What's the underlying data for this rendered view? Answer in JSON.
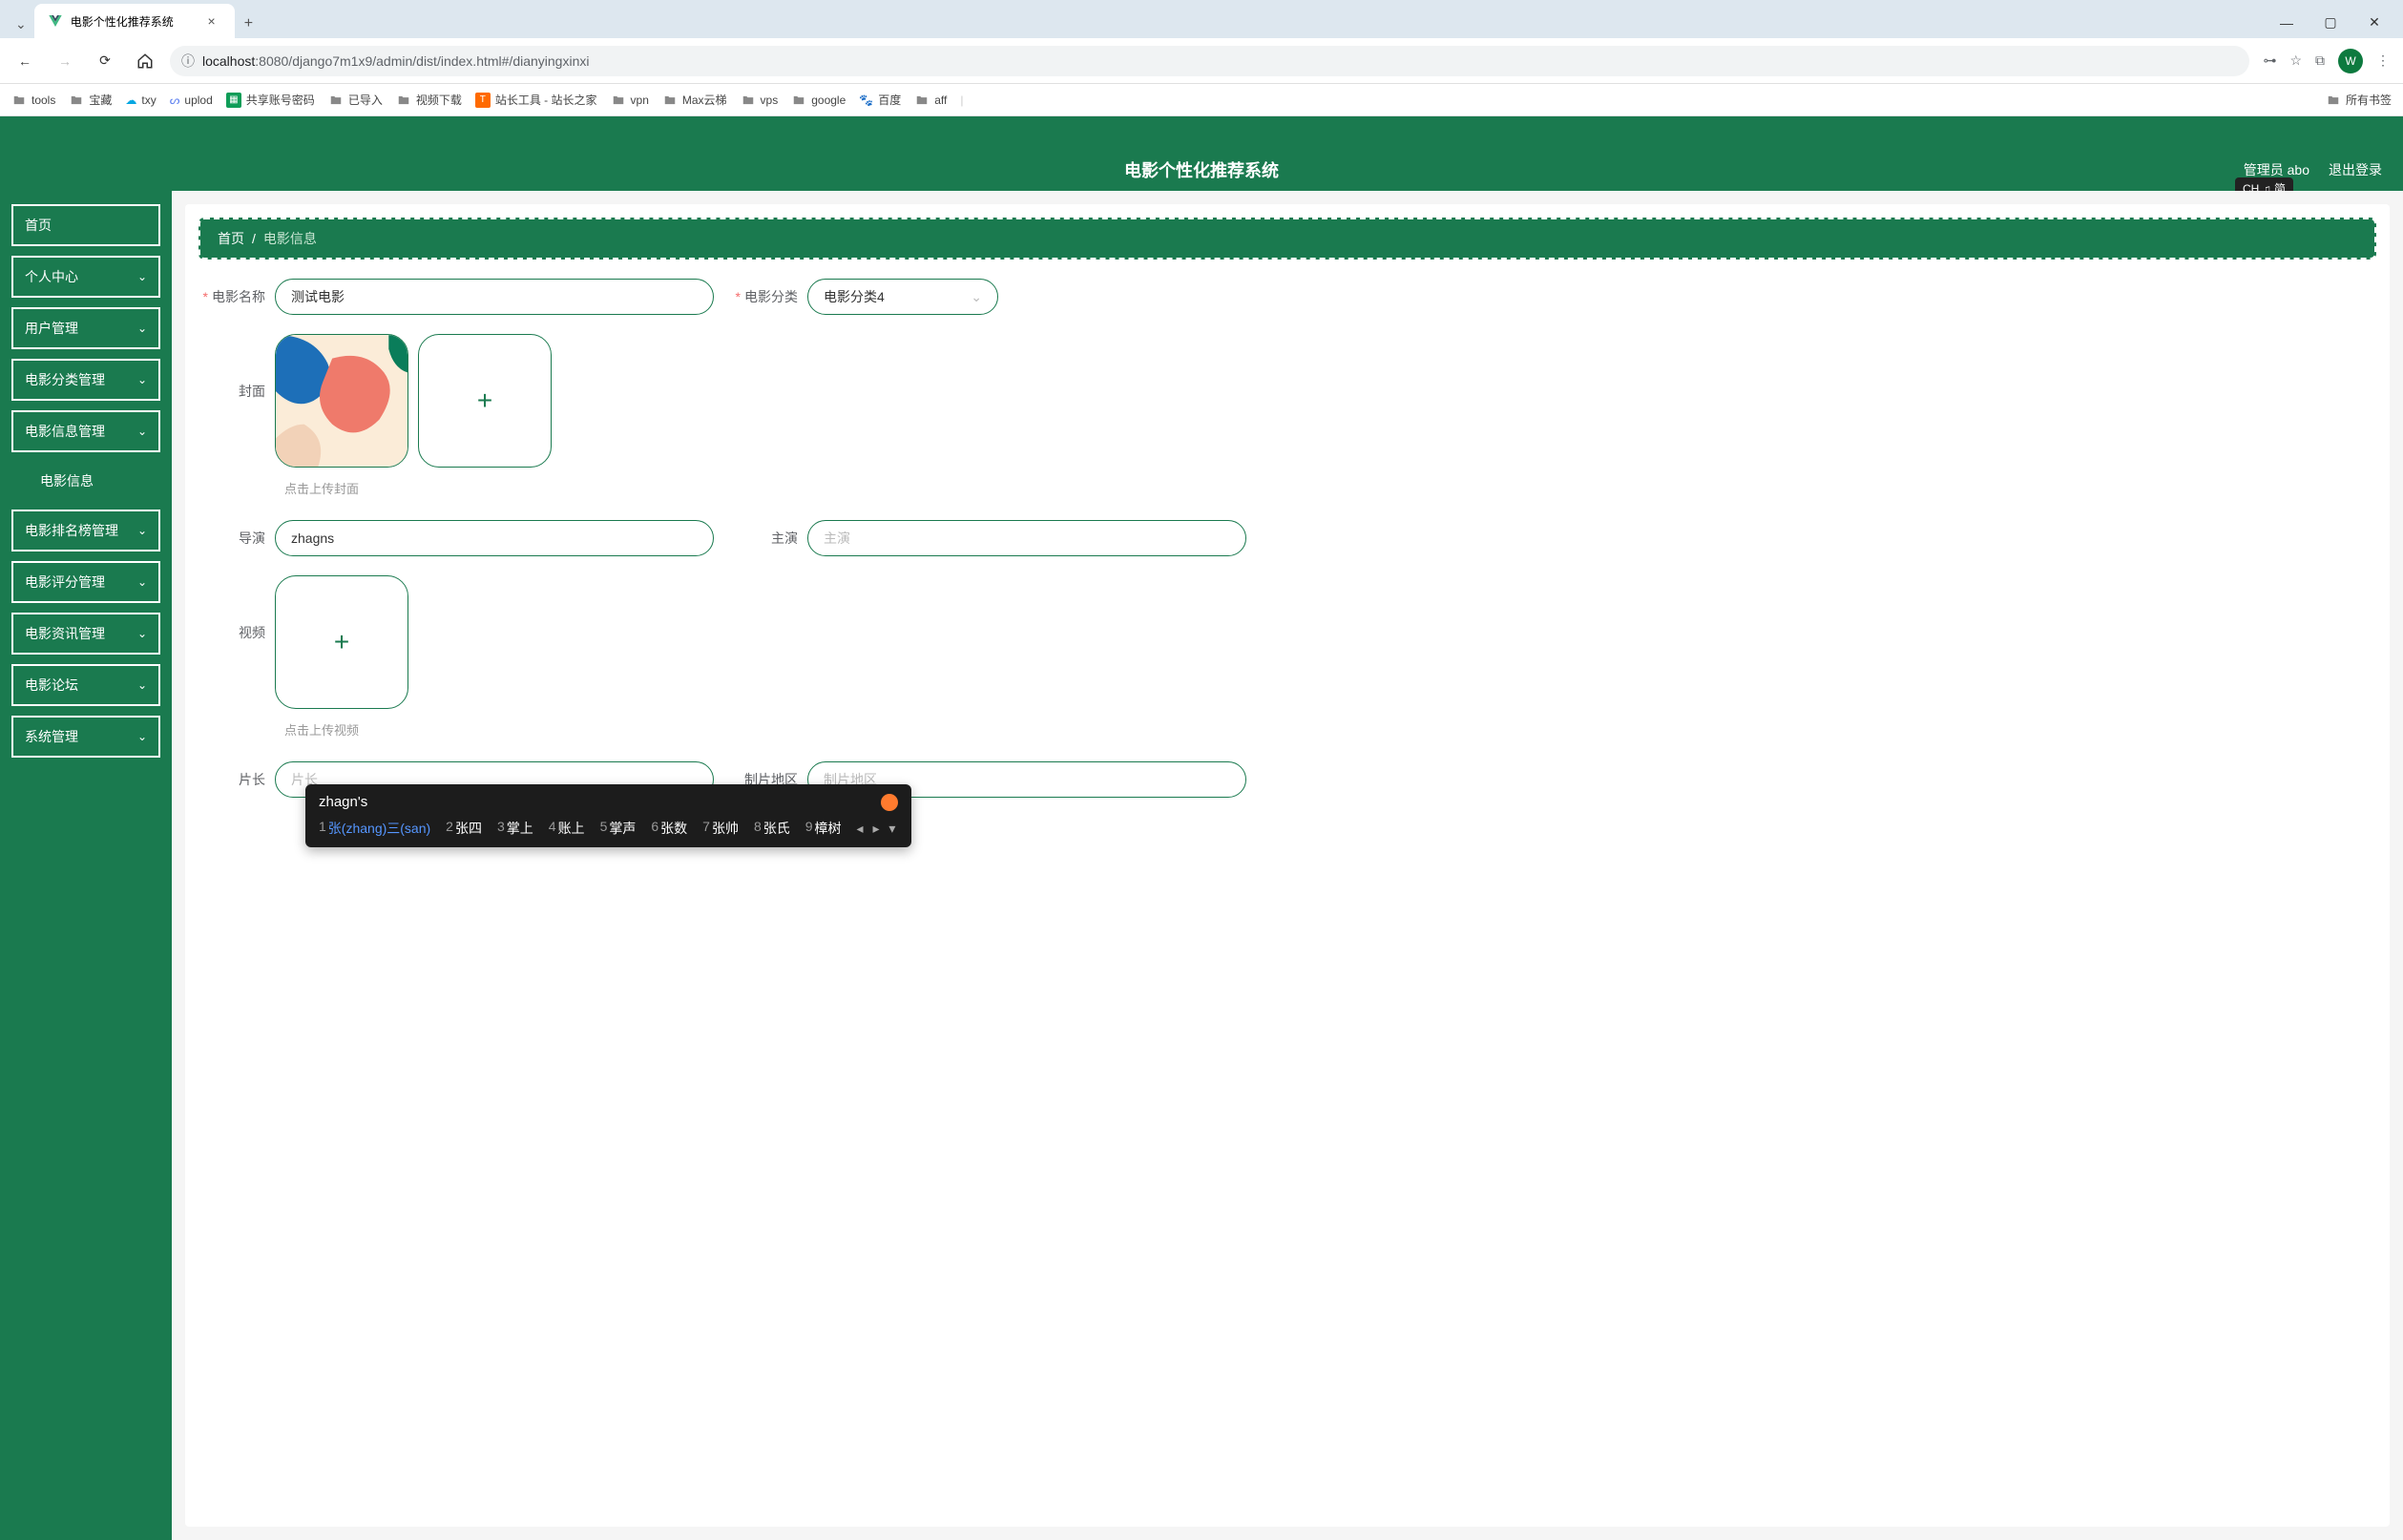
{
  "browser": {
    "tab_title": "电影个性化推荐系统",
    "url_host": "localhost",
    "url_path": ":8080/django7m1x9/admin/dist/index.html#/dianyingxinxi",
    "avatar_letter": "W"
  },
  "bookmarks": {
    "items": [
      "tools",
      "宝藏",
      "txy",
      "uplod",
      "共享账号密码",
      "已导入",
      "视频下载",
      "站长工具 - 站长之家",
      "vpn",
      "Max云梯",
      "vps",
      "google",
      "百度",
      "aff"
    ],
    "all": "所有书签"
  },
  "app": {
    "title": "电影个性化推荐系统",
    "admin_label": "管理员 abo",
    "logout": "退出登录",
    "ime_badge": "CH ♫ 简"
  },
  "sidebar": {
    "items": [
      {
        "label": "首页",
        "has_children": false
      },
      {
        "label": "个人中心",
        "has_children": true
      },
      {
        "label": "用户管理",
        "has_children": true
      },
      {
        "label": "电影分类管理",
        "has_children": true
      },
      {
        "label": "电影信息管理",
        "has_children": true
      },
      {
        "label": "电影排名榜管理",
        "has_children": true
      },
      {
        "label": "电影评分管理",
        "has_children": true
      },
      {
        "label": "电影资讯管理",
        "has_children": true
      },
      {
        "label": "电影论坛",
        "has_children": true
      },
      {
        "label": "系统管理",
        "has_children": true
      }
    ],
    "submenu_movie_info": "电影信息"
  },
  "breadcrumb": {
    "home": "首页",
    "current": "电影信息"
  },
  "form": {
    "movie_name_label": "电影名称",
    "movie_name_value": "测试电影",
    "movie_cat_label": "电影分类",
    "movie_cat_value": "电影分类4",
    "cover_label": "封面",
    "cover_hint": "点击上传封面",
    "director_label": "导演",
    "director_value": "zhagns",
    "actor_label": "主演",
    "actor_placeholder": "主演",
    "video_label": "视频",
    "video_hint": "点击上传视频",
    "duration_label": "片长",
    "duration_placeholder": "片长",
    "region_label": "制片地区",
    "region_placeholder": "制片地区"
  },
  "ime": {
    "compose": "zhagn's",
    "candidates": [
      {
        "n": "1",
        "text": "张(zhang)三(san)",
        "selected": true
      },
      {
        "n": "2",
        "text": "张四"
      },
      {
        "n": "3",
        "text": "掌上"
      },
      {
        "n": "4",
        "text": "账上"
      },
      {
        "n": "5",
        "text": "掌声"
      },
      {
        "n": "6",
        "text": "张数"
      },
      {
        "n": "7",
        "text": "张帅"
      },
      {
        "n": "8",
        "text": "张氏"
      },
      {
        "n": "9",
        "text": "樟树"
      }
    ]
  }
}
